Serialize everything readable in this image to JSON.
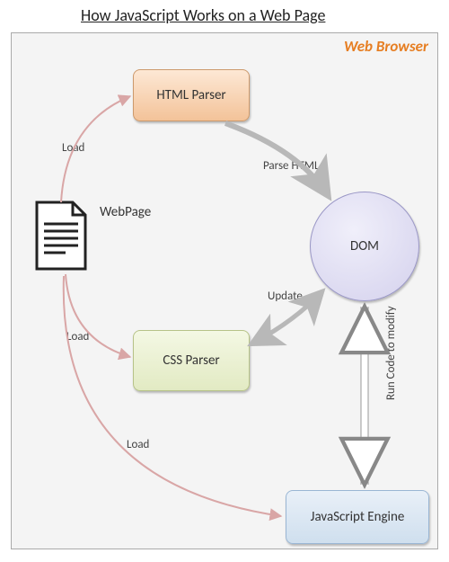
{
  "title": "How JavaScript Works on a Web Page",
  "container_label": "Web Browser",
  "nodes": {
    "webpage": "WebPage",
    "html_parser": "HTML Parser",
    "css_parser": "CSS Parser",
    "dom": "DOM",
    "js_engine": "JavaScript Engine"
  },
  "edges": {
    "load_html": "Load",
    "load_css": "Load",
    "load_js": "Load",
    "parse_html": "Parse HTML",
    "update": "Update",
    "run_code": "Run Code to modify"
  }
}
